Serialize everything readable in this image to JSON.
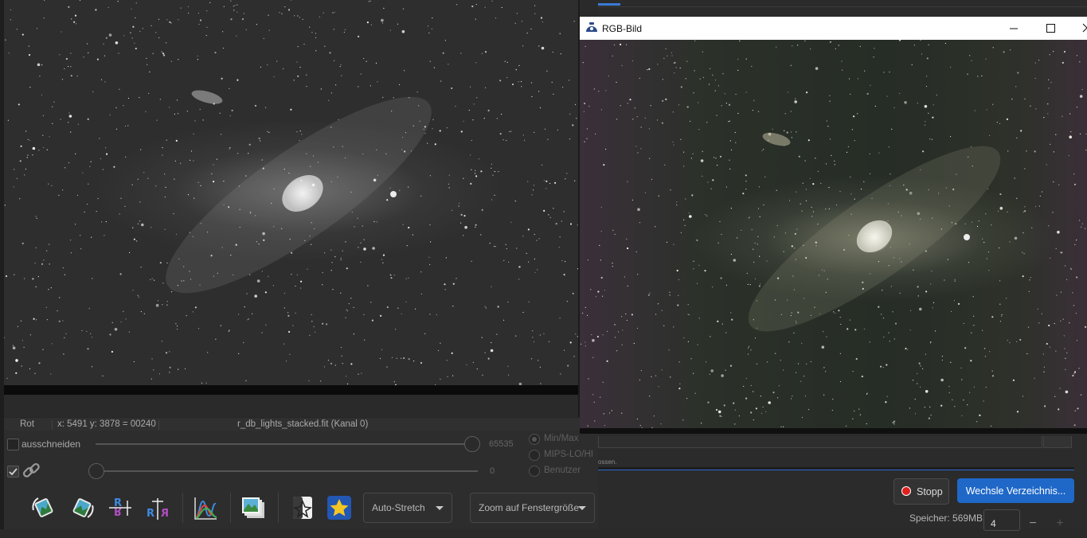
{
  "main_window": {
    "status": {
      "channel": "Rot",
      "coordinates": "x: 5491 y: 3878 = 00240",
      "filename": "r_db_lights_stacked.fit (Kanal 0)"
    },
    "controls": {
      "crop_label": "ausschneiden",
      "crop_checked": false,
      "link_checked": true,
      "high_value": "65535",
      "low_value": "0",
      "scale_options": [
        "Min/Max",
        "MIPS-LO/HI",
        "Benutzer"
      ],
      "scale_selected": "Min/Max"
    },
    "toolbar": {
      "stretch_mode": "Auto-Stretch",
      "zoom_mode": "Zoom auf Fenstergröße",
      "icons": [
        "rotate-left-icon",
        "rotate-right-icon",
        "mirror-vertical-icon",
        "mirror-horizontal-icon",
        "histogram-icon",
        "image-stack-icon",
        "photometry-icon",
        "star-icon"
      ]
    }
  },
  "rgb_window": {
    "title": "RGB-Bild",
    "controls": [
      "minimize",
      "maximize",
      "close"
    ]
  },
  "background_app": {
    "status_text": "ossen.",
    "stop_label": "Stopp",
    "change_dir_label": "Wechsle Verzeichnis...",
    "memory_label": "Speicher: 569MB",
    "threads_value": "4",
    "minus": "−",
    "plus": "+"
  },
  "colors": {
    "accent": "#1f68c8",
    "stop_red": "#e01f1f"
  }
}
